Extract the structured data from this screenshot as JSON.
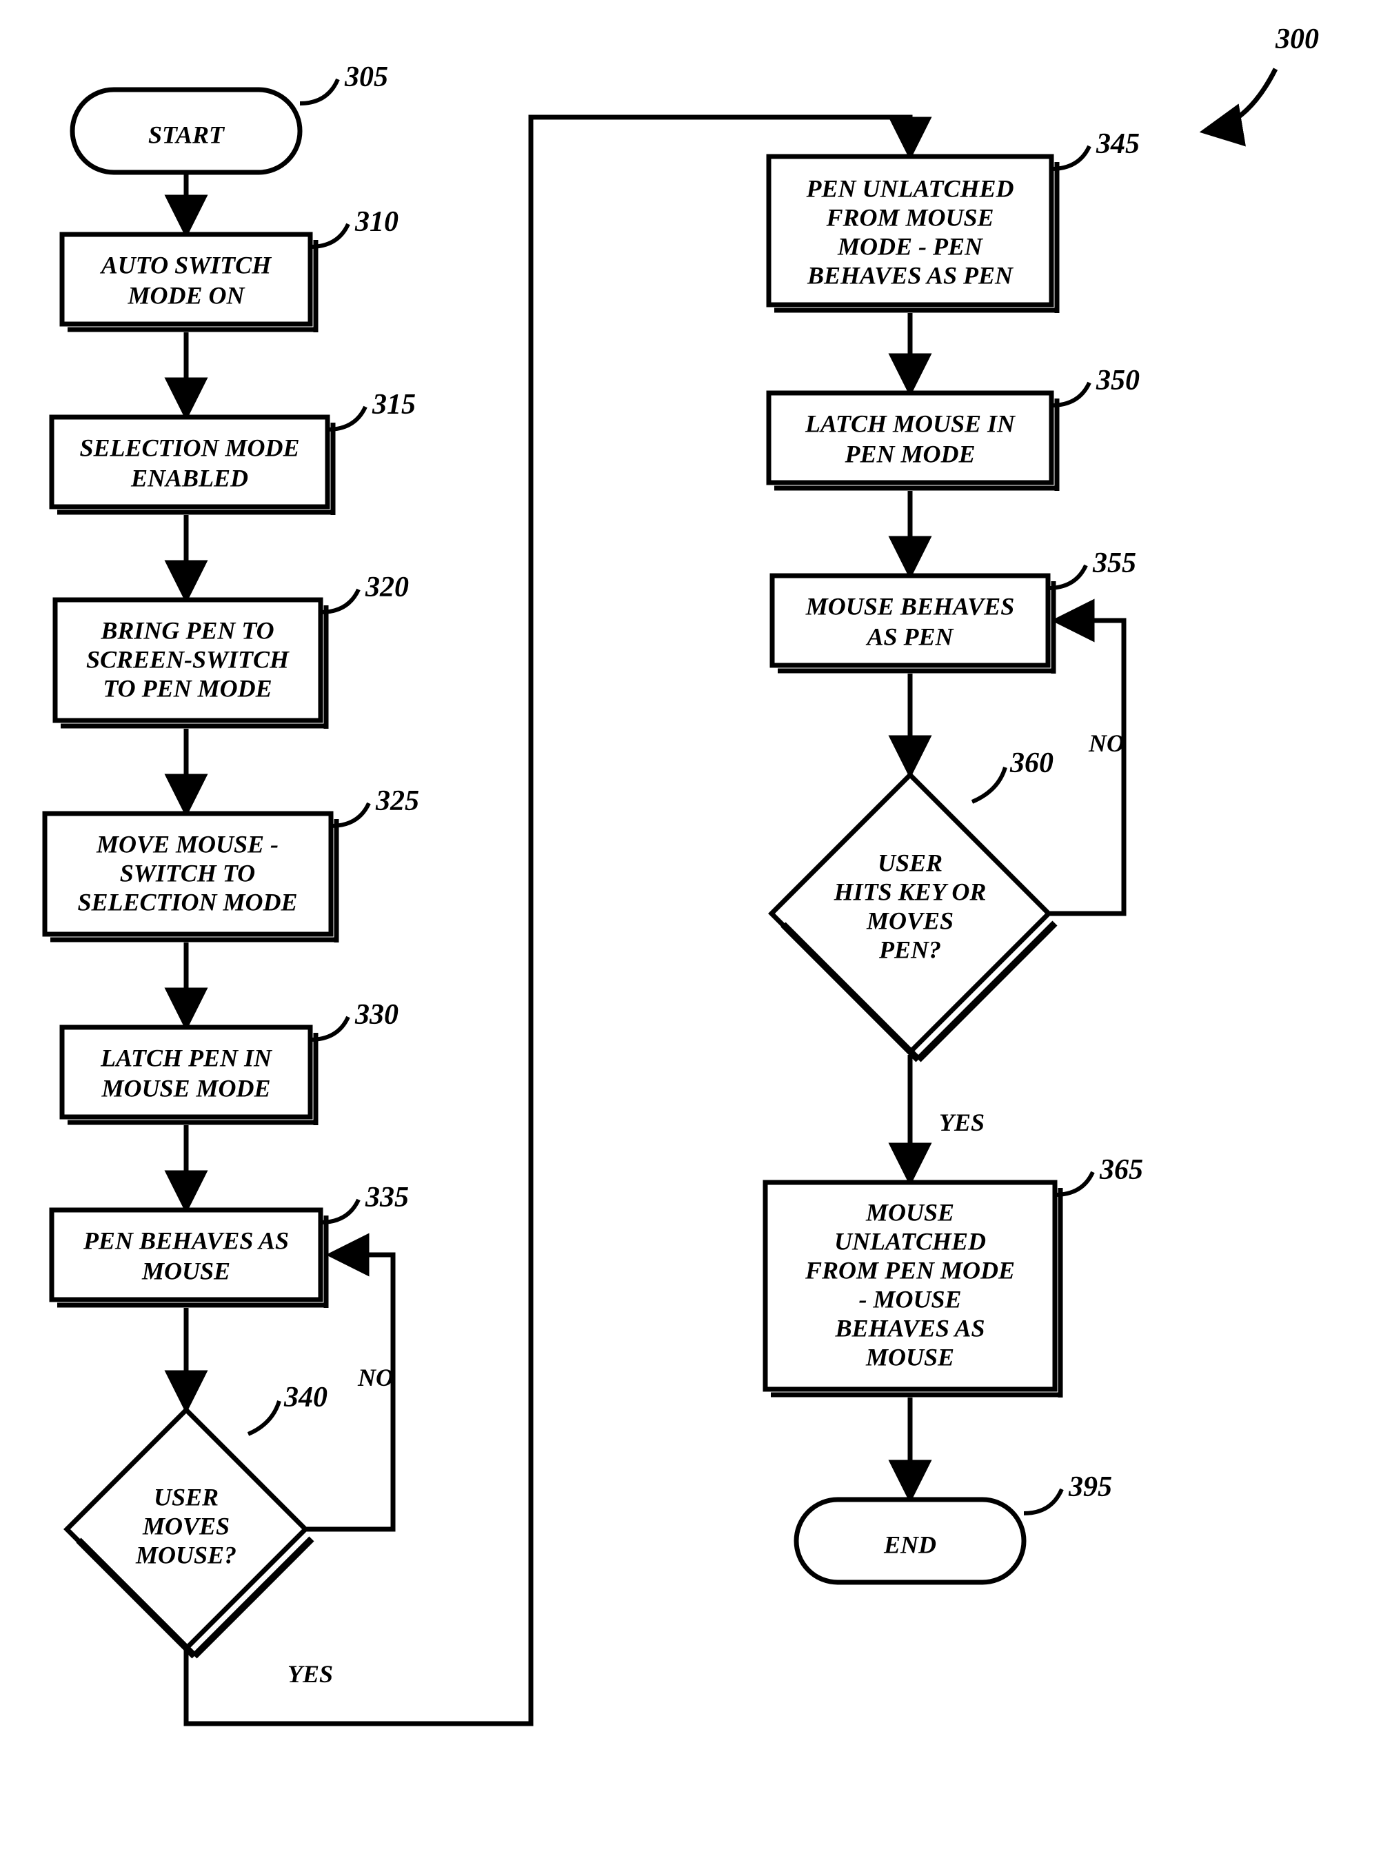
{
  "figureRef": "300",
  "nodes": {
    "305": {
      "ref": "305",
      "label": [
        "START"
      ]
    },
    "310": {
      "ref": "310",
      "label": [
        "AUTO SWITCH",
        "MODE ON"
      ]
    },
    "315": {
      "ref": "315",
      "label": [
        "SELECTION MODE",
        "ENABLED"
      ]
    },
    "320": {
      "ref": "320",
      "label": [
        "BRING PEN TO",
        "SCREEN-SWITCH",
        "TO PEN MODE"
      ]
    },
    "325": {
      "ref": "325",
      "label": [
        "MOVE MOUSE -",
        "SWITCH TO",
        "SELECTION MODE"
      ]
    },
    "330": {
      "ref": "330",
      "label": [
        "LATCH PEN IN",
        "MOUSE MODE"
      ]
    },
    "335": {
      "ref": "335",
      "label": [
        "PEN BEHAVES AS",
        "MOUSE"
      ]
    },
    "340": {
      "ref": "340",
      "label": [
        "USER",
        "MOVES",
        "MOUSE?"
      ]
    },
    "345": {
      "ref": "345",
      "label": [
        "PEN UNLATCHED",
        "FROM MOUSE",
        "MODE - PEN",
        "BEHAVES AS PEN"
      ]
    },
    "350": {
      "ref": "350",
      "label": [
        "LATCH MOUSE IN",
        "PEN MODE"
      ]
    },
    "355": {
      "ref": "355",
      "label": [
        "MOUSE BEHAVES",
        "AS PEN"
      ]
    },
    "360": {
      "ref": "360",
      "label": [
        "USER",
        "HITS  KEY OR",
        "MOVES",
        "PEN?"
      ]
    },
    "365": {
      "ref": "365",
      "label": [
        "MOUSE",
        "UNLATCHED",
        "FROM PEN MODE",
        "- MOUSE",
        "BEHAVES AS",
        "MOUSE"
      ]
    },
    "395": {
      "ref": "395",
      "label": [
        "END"
      ]
    }
  },
  "edges": {
    "yes": "YES",
    "no": "NO"
  }
}
